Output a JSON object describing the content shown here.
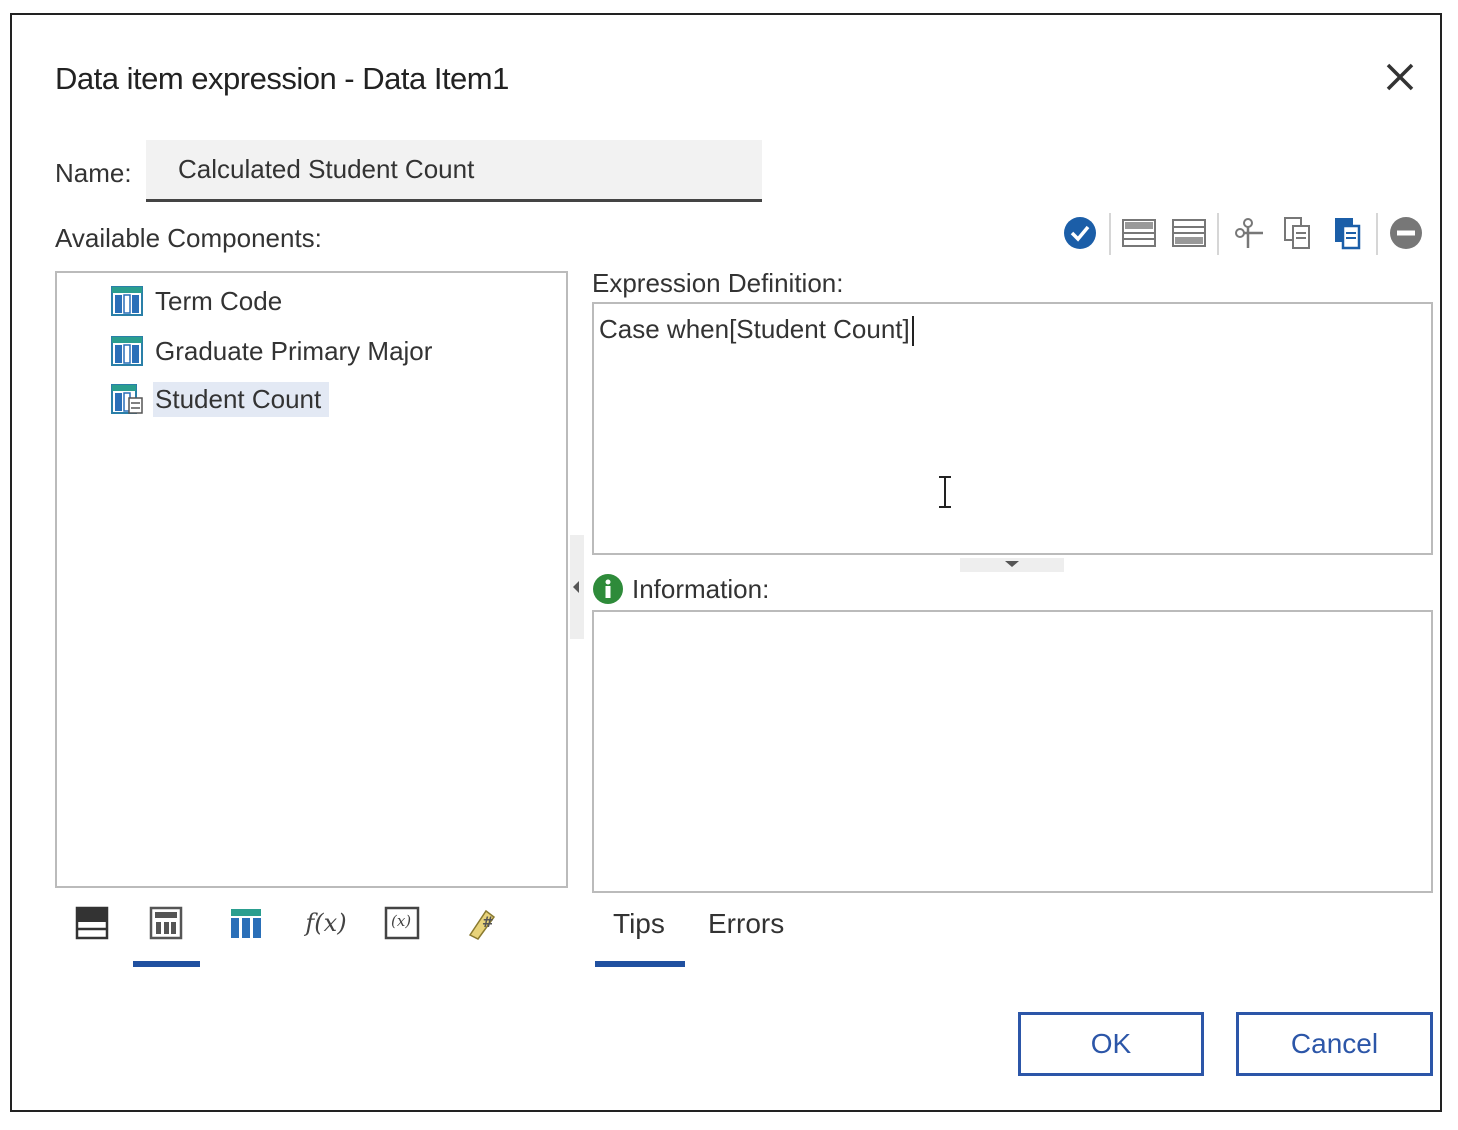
{
  "dialog": {
    "title": "Data item expression - Data Item1"
  },
  "name": {
    "label": "Name:",
    "value": "Calculated Student Count"
  },
  "available_components": {
    "label": "Available Components:",
    "items": [
      {
        "label": "Term Code",
        "icon": "data-column-icon"
      },
      {
        "label": "Graduate Primary Major",
        "icon": "data-column-icon"
      },
      {
        "label": "Student Count",
        "icon": "measure-column-icon",
        "selected": true
      }
    ],
    "tabs": [
      {
        "icon": "source-icon"
      },
      {
        "icon": "data-items-icon",
        "active": true
      },
      {
        "icon": "query-items-icon"
      },
      {
        "icon": "functions-icon",
        "text": "f(x)"
      },
      {
        "icon": "parameters-icon",
        "text": "(x)"
      },
      {
        "icon": "macros-icon"
      }
    ]
  },
  "toolbar": {
    "items": [
      "validate-icon",
      "insert-above-icon",
      "insert-below-icon",
      "cut-icon",
      "copy-icon",
      "paste-icon",
      "remove-icon"
    ]
  },
  "expression": {
    "label": "Expression Definition:",
    "text": "Case when[Student Count]"
  },
  "information": {
    "label": "Information:",
    "tabs": [
      {
        "label": "Tips",
        "active": true
      },
      {
        "label": "Errors"
      }
    ]
  },
  "buttons": {
    "ok": "OK",
    "cancel": "Cancel"
  },
  "colors": {
    "accent": "#2050a0",
    "validate": "#1b5ea8",
    "info": "#2e8b3a",
    "column_icon": "#2a7fa8",
    "selection": "#e3e9f4"
  }
}
